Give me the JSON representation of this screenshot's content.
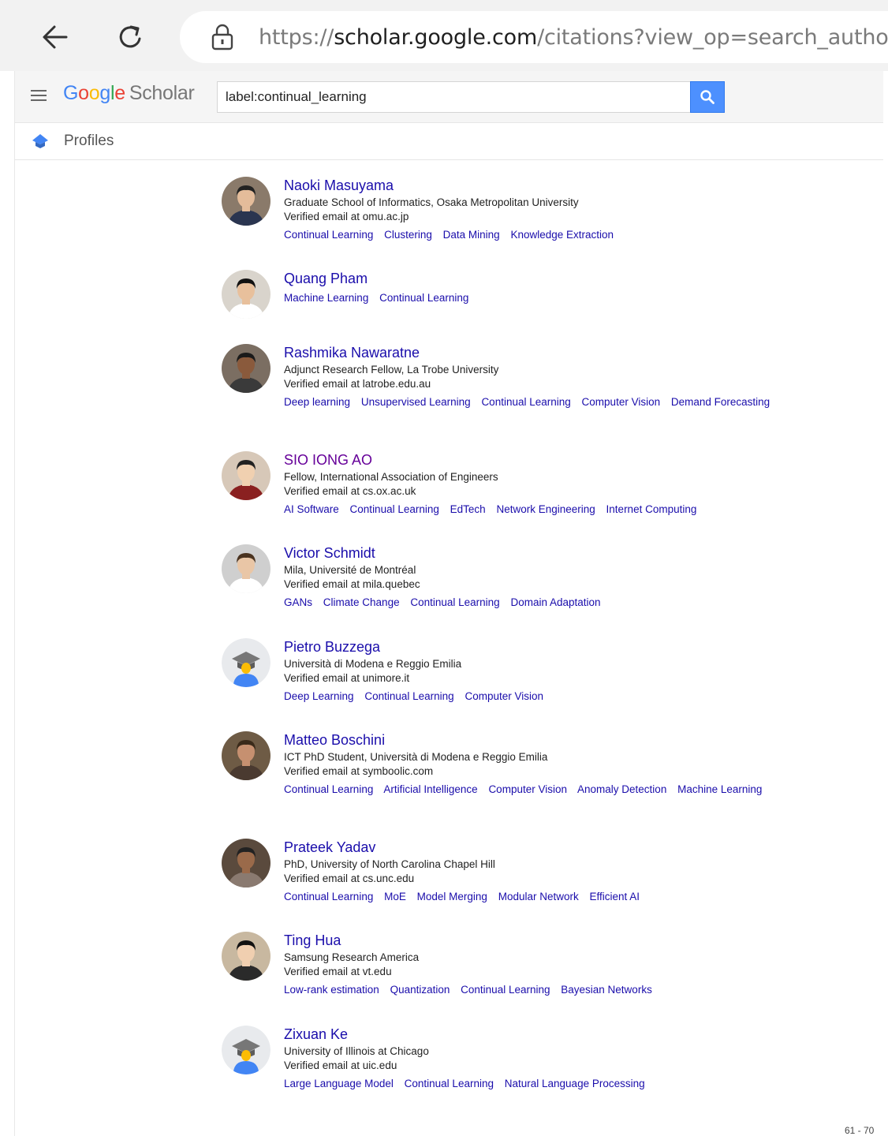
{
  "browser": {
    "url_prefix": "https://",
    "url_domain": "scholar.google.com",
    "url_rest": "/citations?view_op=search_autho"
  },
  "header": {
    "logo_google": [
      "G",
      "o",
      "o",
      "g",
      "l",
      "e"
    ],
    "logo_colors": [
      "#4285f4",
      "#ea4335",
      "#fbbc05",
      "#4285f4",
      "#34a853",
      "#ea4335"
    ],
    "logo_scholar": "Scholar",
    "search_value": "label:continual_learning",
    "accent_color": "#4d90fe"
  },
  "nav": {
    "profiles_label": "Profiles"
  },
  "profiles": [
    {
      "name": "Naoki Masuyama",
      "affiliation": "Graduate School of Informatics, Osaka Metropolitan University",
      "email": "Verified email at omu.ac.jp",
      "interests": [
        "Continual Learning",
        "Clustering",
        "Data Mining",
        "Knowledge Extraction"
      ],
      "avatar": "photo"
    },
    {
      "name": "Quang Pham",
      "affiliation": "",
      "email": "",
      "interests": [
        "Machine Learning",
        "Continual Learning"
      ],
      "avatar": "photo"
    },
    {
      "name": "Rashmika Nawaratne",
      "affiliation": "Adjunct Research Fellow, La Trobe University",
      "email": "Verified email at latrobe.edu.au",
      "interests": [
        "Deep learning",
        "Unsupervised Learning",
        "Continual Learning",
        "Computer Vision",
        "Demand Forecasting"
      ],
      "avatar": "photo"
    },
    {
      "name": "SIO IONG AO",
      "affiliation": "Fellow, International Association of Engineers",
      "email": "Verified email at cs.ox.ac.uk",
      "interests": [
        "AI Software",
        "Continual Learning",
        "EdTech",
        "Network Engineering",
        "Internet Computing"
      ],
      "avatar": "photo",
      "visited": true
    },
    {
      "name": "Victor Schmidt",
      "affiliation": "Mila, Université de Montréal",
      "email": "Verified email at mila.quebec",
      "interests": [
        "GANs",
        "Climate Change",
        "Continual Learning",
        "Domain Adaptation"
      ],
      "avatar": "photo"
    },
    {
      "name": "Pietro Buzzega",
      "affiliation": "Università di Modena e Reggio Emilia",
      "email": "Verified email at unimore.it",
      "interests": [
        "Deep Learning",
        "Continual Learning",
        "Computer Vision"
      ],
      "avatar": "placeholder"
    },
    {
      "name": "Matteo Boschini",
      "affiliation": "ICT PhD Student, Università di Modena e Reggio Emilia",
      "email": "Verified email at symboolic.com",
      "interests": [
        "Continual Learning",
        "Artificial Intelligence",
        "Computer Vision",
        "Anomaly Detection",
        "Machine Learning"
      ],
      "avatar": "photo"
    },
    {
      "name": "Prateek Yadav",
      "affiliation": "PhD, University of North Carolina Chapel Hill",
      "email": "Verified email at cs.unc.edu",
      "interests": [
        "Continual Learning",
        "MoE",
        "Model Merging",
        "Modular Network",
        "Efficient AI"
      ],
      "avatar": "photo"
    },
    {
      "name": "Ting Hua",
      "affiliation": "Samsung Research America",
      "email": "Verified email at vt.edu",
      "interests": [
        "Low-rank estimation",
        "Quantization",
        "Continual Learning",
        "Bayesian Networks"
      ],
      "avatar": "photo"
    },
    {
      "name": "Zixuan Ke",
      "affiliation": "University of Illinois at Chicago",
      "email": "Verified email at uic.edu",
      "interests": [
        "Large Language Model",
        "Continual Learning",
        "Natural Language Processing"
      ],
      "avatar": "placeholder"
    }
  ],
  "pager": {
    "range": "61 - 70"
  }
}
